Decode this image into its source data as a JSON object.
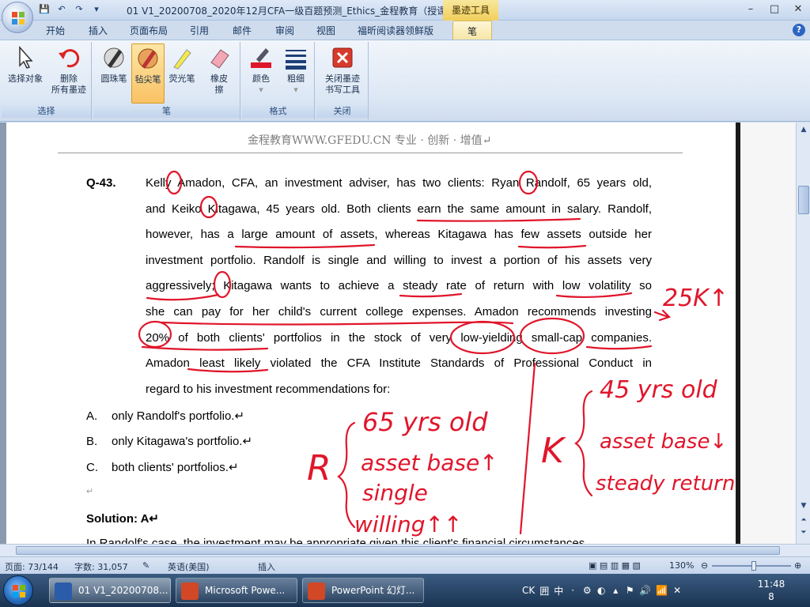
{
  "window": {
    "title": "01 V1_20200708_2020年12月CFA一级百题预测_Ethics_金程教育（授课... M",
    "ink_tools_tab": "墨迹工具",
    "controls": [
      "–",
      "□",
      "✕"
    ]
  },
  "qat": [
    "💾",
    "↶",
    "↷",
    "▾"
  ],
  "tabs": [
    "开始",
    "插入",
    "页面布局",
    "引用",
    "邮件",
    "审阅",
    "视图",
    "福昕阅读器领鲜版",
    "笔"
  ],
  "ribbon": {
    "select_group": {
      "label": "选择",
      "select_object": "选择对象",
      "delete_ink_l1": "删除",
      "delete_ink_l2": "所有墨迹"
    },
    "pen_group": {
      "label": "笔",
      "ballpoint": "圆珠笔",
      "felt": "毡尖笔",
      "highlighter": "荧光笔",
      "eraser_l1": "橡皮",
      "eraser_l2": "擦"
    },
    "format_group": {
      "label": "格式",
      "color": "颜色",
      "thickness": "粗细"
    },
    "close_group": {
      "label": "关闭",
      "close_l1": "关闭墨迹",
      "close_l2": "书写工具"
    }
  },
  "document": {
    "header": "金程教育WWW.GFEDU.CN 专业 · 创新 · 增值↵",
    "question_number": "Q-43.",
    "question_lines": [
      "Kelly Amadon, CFA, an investment adviser, has two clients: Ryan Randolf, 65 years old,",
      "and Keiko Kitagawa, 45 years old. Both clients earn the same amount in salary. Randolf,",
      "however, has a large amount of assets, whereas Kitagawa has few assets outside her",
      "investment portfolio. Randolf is single and willing to invest a portion of his assets very",
      "aggressively; Kitagawa wants to achieve a steady rate of return with low volatility so",
      "she can pay for her child's current college expenses. Amadon recommends investing",
      "20% of both clients' portfolios in the stock of very low-yielding small-cap companies.",
      "Amadon least likely violated the CFA Institute Standards of Professional Conduct in",
      "regard to his investment recommendations for:"
    ],
    "options": [
      {
        "letter": "A.",
        "text": "only Randolf's portfolio.↵"
      },
      {
        "letter": "B.",
        "text": "only Kitagawa's portfolio.↵"
      },
      {
        "letter": "C.",
        "text": "both clients' portfolios.↵"
      }
    ],
    "empty_para": "↵",
    "solution": "Solution: A↵",
    "cut_line": "In Randolf's case, the investment may be appropriate given this client's financial circumstances"
  },
  "handwriting": {
    "risk_note": "25K↑",
    "r_letter": "R",
    "r_items": [
      "65 yrs old",
      "asset base↑",
      "single",
      "willing↑↑"
    ],
    "k_letter": "K",
    "k_items": [
      "45 yrs old",
      "asset base↓",
      "steady return"
    ]
  },
  "status": {
    "page": "页面: 73/144",
    "words": "字数: 31,057",
    "language": "英语(美国)",
    "mode": "插入",
    "zoom": "130%"
  },
  "taskbar": {
    "tasks": [
      {
        "label": "01 V1_20200708...",
        "color": "#2b5caa"
      },
      {
        "label": "Microsoft Powe...",
        "color": "#d24726"
      },
      {
        "label": "PowerPoint 幻灯...",
        "color": "#d24726"
      }
    ],
    "tray": [
      "CK",
      "囲",
      "中",
      "·",
      "⚙",
      "◐",
      "▴",
      "⚑",
      "🔊",
      "📶",
      "✕"
    ],
    "time": "11:48",
    "date": "8"
  },
  "colors": {
    "ink": "#e0162b",
    "accent": "#f6d26b"
  }
}
